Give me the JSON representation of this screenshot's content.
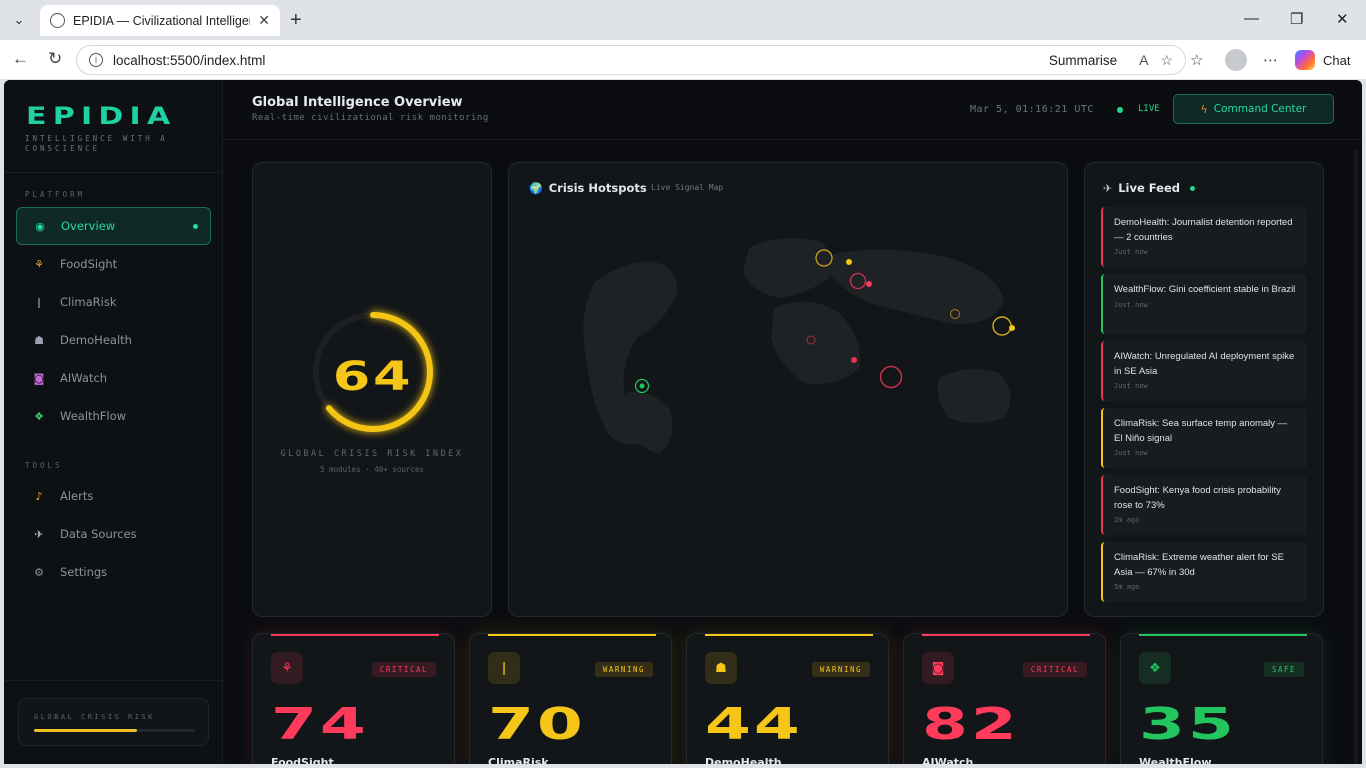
{
  "browser": {
    "tab_title": "EPIDIA — Civilizational Intelligence",
    "url": "localhost:5500/index.html",
    "summarise_label": "Summarise",
    "chat_label": "Chat"
  },
  "sidebar": {
    "logo": "EPIDIA",
    "tagline": "INTELLIGENCE WITH A CONSCIENCE",
    "platform_label": "PLATFORM",
    "tools_label": "TOOLS",
    "platform_items": [
      {
        "label": "Overview",
        "icon": "overview-icon",
        "active": true
      },
      {
        "label": "FoodSight",
        "icon": "wheat-icon"
      },
      {
        "label": "ClimaRisk",
        "icon": "thermometer-icon"
      },
      {
        "label": "DemoHealth",
        "icon": "population-icon"
      },
      {
        "label": "AIWatch",
        "icon": "robot-icon"
      },
      {
        "label": "WealthFlow",
        "icon": "money-icon"
      }
    ],
    "tool_items": [
      {
        "label": "Alerts",
        "icon": "bell-icon"
      },
      {
        "label": "Data Sources",
        "icon": "satellite-icon"
      },
      {
        "label": "Settings",
        "icon": "gear-icon"
      }
    ],
    "risk_mini": {
      "label": "GLOBAL CRISIS RISK",
      "value": 0.64,
      "color": "#f0c020"
    }
  },
  "header": {
    "title": "Global Intelligence Overview",
    "subtitle": "Real-time civilizational risk monitoring",
    "clock": "Mar 5, 01:16:21 UTC",
    "live": "LIVE",
    "command_center": "Command Center"
  },
  "gauge": {
    "value": "64",
    "fraction": 0.64,
    "label": "GLOBAL CRISIS RISK INDEX",
    "sub": "5 modules · 40+ sources",
    "color": "#f5c518"
  },
  "map": {
    "title": "Crisis Hotspots",
    "subtitle": "Live Signal Map"
  },
  "feed": {
    "title": "Live Feed",
    "items": [
      {
        "text": "DemoHealth: Journalist detention reported — 2 countries",
        "time": "Just now",
        "color": "#e8394d"
      },
      {
        "text": "WealthFlow: Gini coefficient stable in Brazil",
        "time": "Just now",
        "color": "#22c55e"
      },
      {
        "text": "AIWatch: Unregulated AI deployment spike in SE Asia",
        "time": "Just now",
        "color": "#e8394d"
      },
      {
        "text": "ClimaRisk: Sea surface temp anomaly — El Niño signal",
        "time": "Just now",
        "color": "#f5c518"
      },
      {
        "text": "FoodSight: Kenya food crisis probability rose to 73%",
        "time": "2m ago",
        "color": "#e8394d"
      },
      {
        "text": "ClimaRisk: Extreme weather alert for SE Asia — 67% in 30d",
        "time": "5m ago",
        "color": "#f5c518"
      }
    ]
  },
  "modules": [
    {
      "name": "FoodSight",
      "value": "74",
      "status": "CRITICAL",
      "color": "#ff3b5c",
      "icon": "wheat-icon"
    },
    {
      "name": "ClimaRisk",
      "value": "70",
      "status": "WARNING",
      "color": "#f5c518",
      "icon": "thermometer-icon"
    },
    {
      "name": "DemoHealth",
      "value": "44",
      "status": "WARNING",
      "color": "#f5c518",
      "icon": "population-icon"
    },
    {
      "name": "AIWatch",
      "value": "82",
      "status": "CRITICAL",
      "color": "#ff3b5c",
      "icon": "robot-icon"
    },
    {
      "name": "WealthFlow",
      "value": "35",
      "status": "SAFE",
      "color": "#22c55e",
      "icon": "money-icon"
    }
  ]
}
